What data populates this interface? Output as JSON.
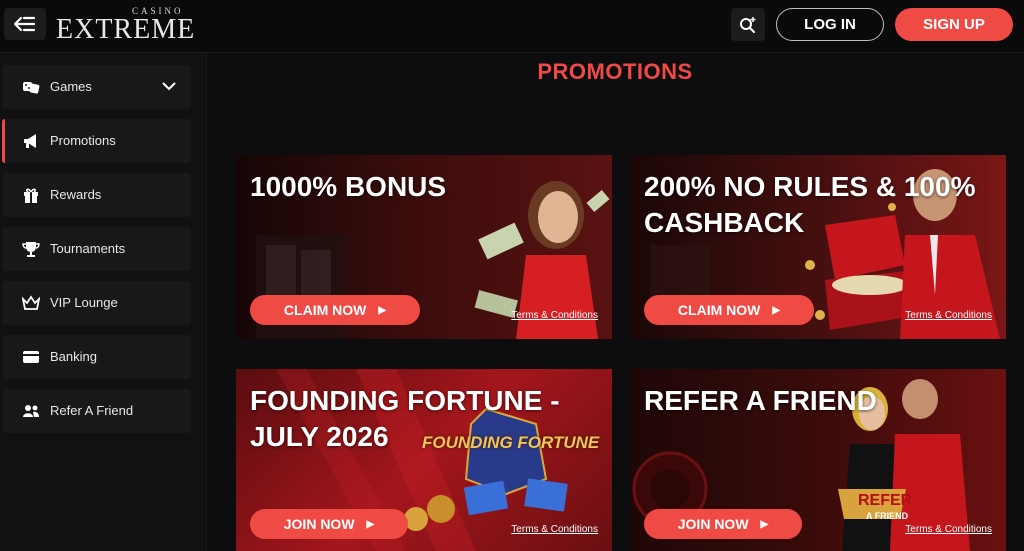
{
  "header": {
    "logo_small": "CASINO",
    "logo_big": "EXTREME",
    "login": "LOG IN",
    "signup": "SIGN UP"
  },
  "sidebar": {
    "items": [
      {
        "label": "Games",
        "icon": "dice-icon"
      },
      {
        "label": "Promotions",
        "icon": "megaphone-icon"
      },
      {
        "label": "Rewards",
        "icon": "gift-icon"
      },
      {
        "label": "Tournaments",
        "icon": "trophy-icon"
      },
      {
        "label": "VIP Lounge",
        "icon": "crown-icon"
      },
      {
        "label": "Banking",
        "icon": "card-icon"
      },
      {
        "label": "Refer A Friend",
        "icon": "users-icon"
      }
    ]
  },
  "main": {
    "title": "PROMOTIONS",
    "cards": [
      {
        "title": "1000% BONUS",
        "button": "CLAIM NOW",
        "terms": "Terms & Conditions"
      },
      {
        "title": "200% NO RULES & 100% CASHBACK",
        "button": "CLAIM NOW",
        "terms": "Terms & Conditions"
      },
      {
        "title": "FOUNDING FORTUNE - JULY 2026",
        "button": "JOIN NOW",
        "terms": "Terms & Conditions",
        "art_text": "FOUNDING FORTUNE"
      },
      {
        "title": "REFER A FRIEND",
        "button": "JOIN NOW",
        "terms": "Terms & Conditions",
        "art_text_1": "REFER",
        "art_text_2": "A FRIEND"
      }
    ]
  },
  "colors": {
    "accent": "#f04a45",
    "background": "#0d0d0f",
    "sidebar": "#18181b"
  }
}
